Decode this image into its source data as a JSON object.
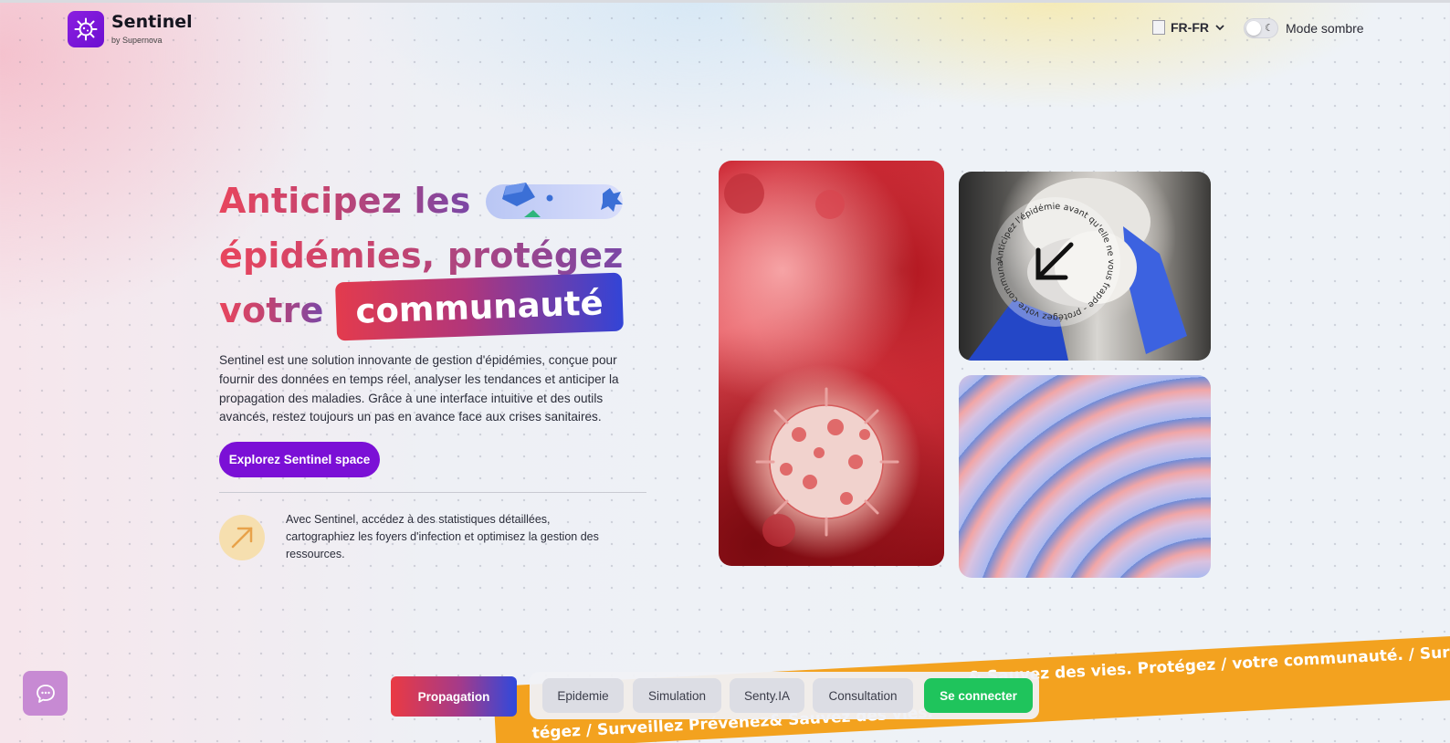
{
  "brand": {
    "name": "Sentinel",
    "subtitle": "by Supernova"
  },
  "header": {
    "language": "FR-FR",
    "dark_mode_label": "Mode sombre"
  },
  "hero": {
    "line1": "Anticipez les",
    "line2": "épidémies, protégez",
    "line3": "votre",
    "highlight": "communauté",
    "description": "Sentinel est une solution innovante de gestion d'épidémies, conçue pour fournir des données en temps réel, analyser les tendances et anticiper la propagation des maladies. Grâce à une interface intuitive et des outils avancés, restez toujours un pas en avance face aux crises sanitaires.",
    "cta_label": "Explorez Sentinel space",
    "feature_text": "Avec Sentinel, accédez à des statistiques détaillées, cartographiez les foyers d'infection et optimisez la gestion des ressources."
  },
  "badge_text": "Anticipez l'épidémie avant qu'elle ne vous frappe - protégez votre communauté",
  "ticker": {
    "top": "& Sauvez des vies.    Protégez / votre communauté.    / Surveillez Pré",
    "bottom": "tégez / Surveillez Prévenez& Sauvez des vies."
  },
  "nav": {
    "active": "Propagation",
    "items": [
      "Epidemie",
      "Simulation",
      "Senty.IA",
      "Consultation"
    ],
    "login": "Se connecter"
  },
  "colors": {
    "brand_purple": "#7b10d6",
    "login_green": "#1fc45c",
    "ticker_orange": "#f3a21f"
  },
  "icons": {
    "logo": "virus-icon",
    "chat": "chat-bubble-icon",
    "arrow": "arrow-up-right-icon",
    "badge_arrow": "arrow-down-left-icon",
    "lang": "chevron-down-icon",
    "moon": "moon-icon"
  }
}
